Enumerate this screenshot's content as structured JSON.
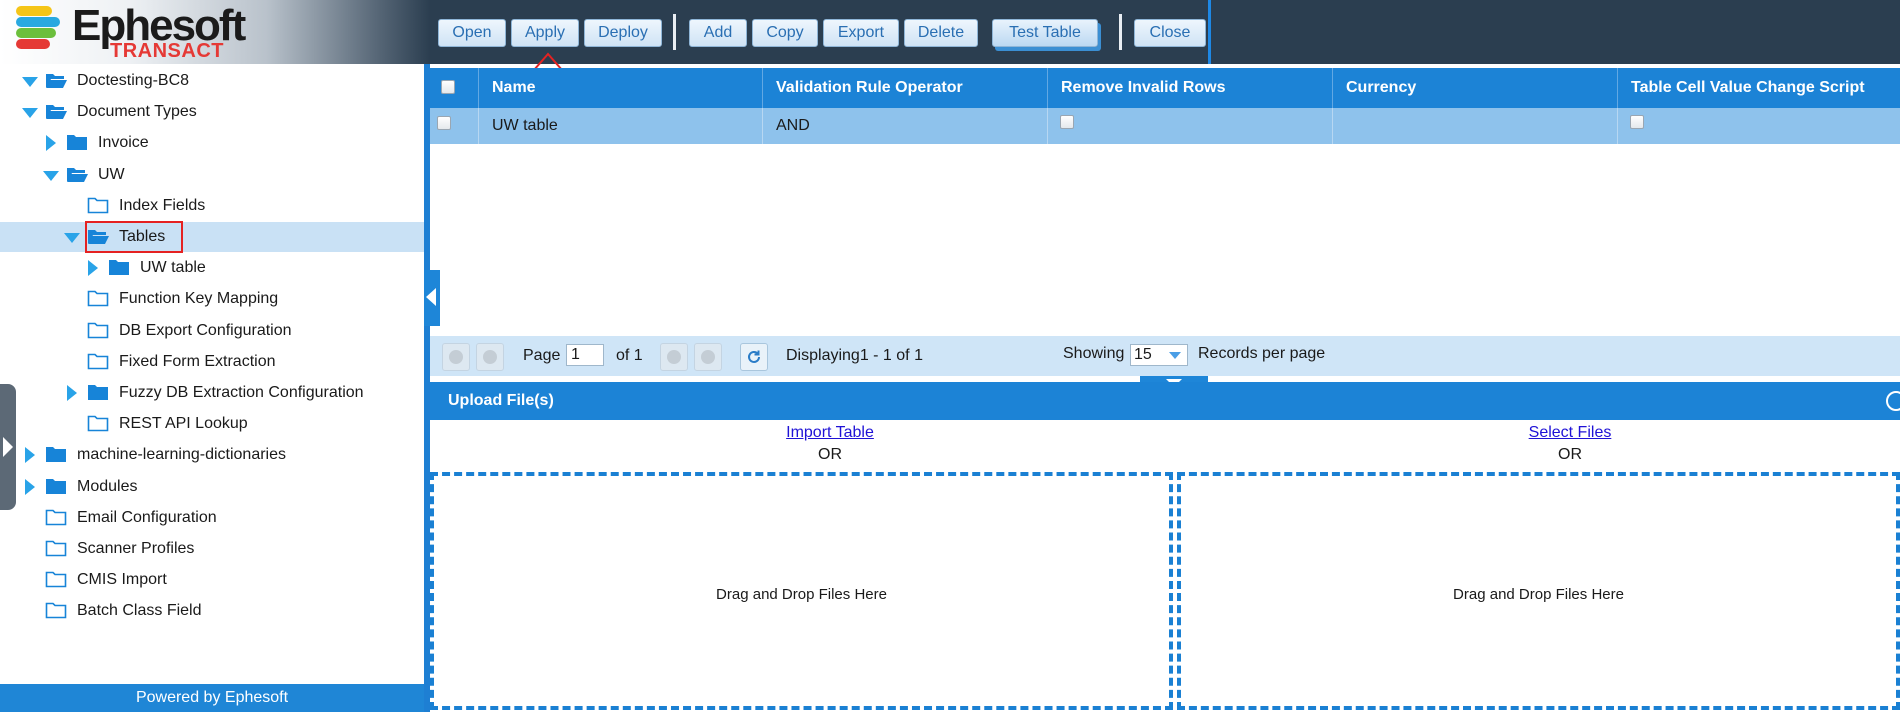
{
  "header": {
    "logo_text": "Ephesoft",
    "logo_sub": "TRANSACT",
    "toolbar": {
      "open": "Open",
      "apply": "Apply",
      "deploy": "Deploy",
      "add": "Add",
      "copy": "Copy",
      "export": "Export",
      "delete": "Delete",
      "test_table": "Test Table",
      "close": "Close"
    }
  },
  "sidebar": {
    "tree": [
      {
        "label": "Doctesting-BC8",
        "icon": "folder-open-icon",
        "expand": "expanded"
      },
      {
        "label": "Document Types",
        "icon": "folder-open-icon",
        "expand": "expanded"
      },
      {
        "label": "Invoice",
        "icon": "folder-icon",
        "expand": "collapsed"
      },
      {
        "label": "UW",
        "icon": "folder-open-icon",
        "expand": "expanded"
      },
      {
        "label": "Index Fields",
        "icon": "folder-outline-icon",
        "expand": "none"
      },
      {
        "label": "Tables",
        "icon": "folder-open-icon",
        "expand": "expanded"
      },
      {
        "label": "UW table",
        "icon": "folder-icon",
        "expand": "collapsed"
      },
      {
        "label": "Function Key Mapping",
        "icon": "folder-outline-icon",
        "expand": "none"
      },
      {
        "label": "DB Export Configuration",
        "icon": "folder-outline-icon",
        "expand": "none"
      },
      {
        "label": "Fixed Form Extraction",
        "icon": "folder-outline-icon",
        "expand": "none"
      },
      {
        "label": "Fuzzy DB Extraction Configuration",
        "icon": "folder-icon",
        "expand": "collapsed"
      },
      {
        "label": "REST API Lookup",
        "icon": "folder-outline-icon",
        "expand": "none"
      },
      {
        "label": "machine-learning-dictionaries",
        "icon": "folder-icon",
        "expand": "collapsed"
      },
      {
        "label": "Modules",
        "icon": "folder-icon",
        "expand": "collapsed"
      },
      {
        "label": "Email Configuration",
        "icon": "folder-outline-icon",
        "expand": "none"
      },
      {
        "label": "Scanner Profiles",
        "icon": "folder-outline-icon",
        "expand": "none"
      },
      {
        "label": "CMIS Import",
        "icon": "folder-outline-icon",
        "expand": "none"
      },
      {
        "label": "Batch Class Field",
        "icon": "folder-outline-icon",
        "expand": "none"
      }
    ],
    "selected_item": "Tables",
    "footer": "Powered by Ephesoft"
  },
  "grid": {
    "columns": [
      "Name",
      "Validation Rule Operator",
      "Remove Invalid Rows",
      "Currency",
      "Table Cell Value Change Script"
    ],
    "rows": [
      {
        "name": "UW table",
        "operator": "AND",
        "remove_invalid_rows": false,
        "currency": "",
        "script_checked": false,
        "selected": false
      }
    ]
  },
  "pager": {
    "page_label": "Page",
    "page_value": "1",
    "of_label": "of 1",
    "displaying": "Displaying1 - 1 of 1",
    "showing_label": "Showing",
    "records_per_page": "15",
    "records_label": "Records per page"
  },
  "upload": {
    "title": "Upload File(s)",
    "import_table": "Import Table",
    "select_files": "Select Files",
    "or": "OR",
    "drop_text": "Drag and Drop Files Here"
  },
  "colors": {
    "header_bg": "#2b3e50",
    "accent_blue": "#1c83d6",
    "selected_row": "#c9e1f5",
    "logo_red": "#e53935"
  }
}
